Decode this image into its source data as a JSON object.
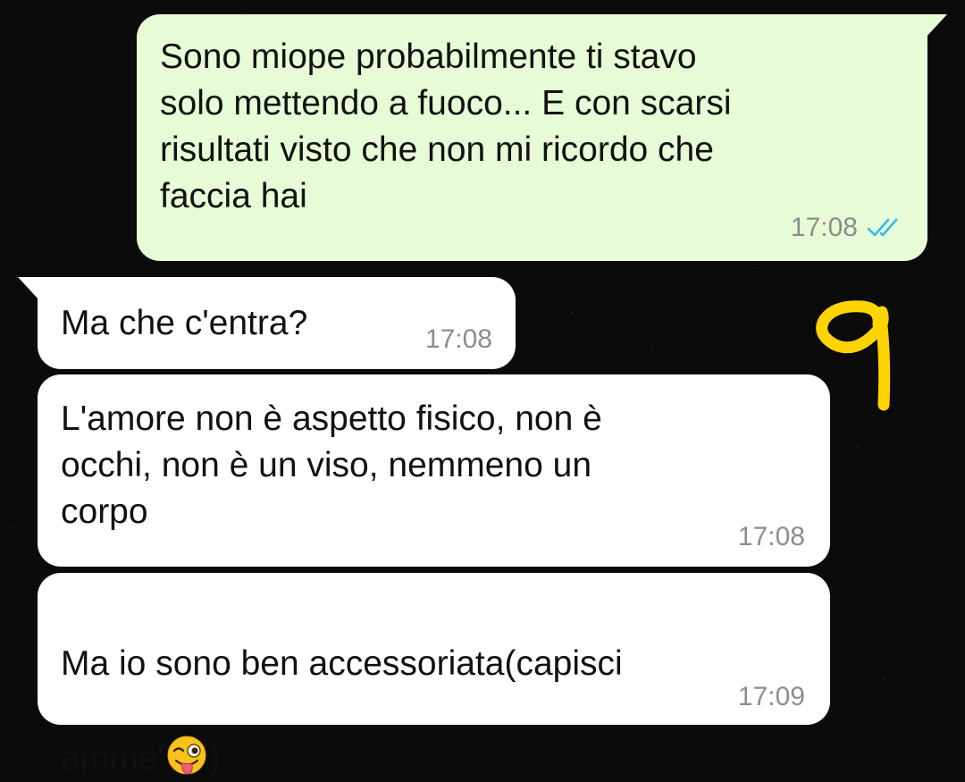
{
  "messages": [
    {
      "direction": "outgoing",
      "text": "Sono miope probabilmente ti stavo\nsolo mettendo a fuoco... E con scarsi\nrisultati visto che non mi ricordo che\nfaccia hai",
      "time": "17:08",
      "status_icon": "double-check-read-icon"
    },
    {
      "direction": "incoming",
      "text": "Ma che c'entra?",
      "time": "17:08"
    },
    {
      "direction": "incoming",
      "text": "L'amore non è aspetto fisico, non è\nocchi, non è un viso, nemmeno un\ncorpo",
      "time": "17:08"
    },
    {
      "direction": "incoming",
      "text_line1": "Ma io sono ben accessoriata(capisci",
      "text_line2_before": "amme'",
      "emoji_icon": "winking-face-with-tongue-icon",
      "text_line2_after": ")",
      "time": "17:09"
    }
  ],
  "colors": {
    "background": "#0b0b0b",
    "outgoing_bubble": "#e7fcd6",
    "incoming_bubble": "#ffffff",
    "timestamp": "#8d8d8d",
    "read_ticks": "#34b7f1",
    "doodle": "#ffd400"
  },
  "annotation_icon": "yellow-hand-drawn-nine-doodle"
}
